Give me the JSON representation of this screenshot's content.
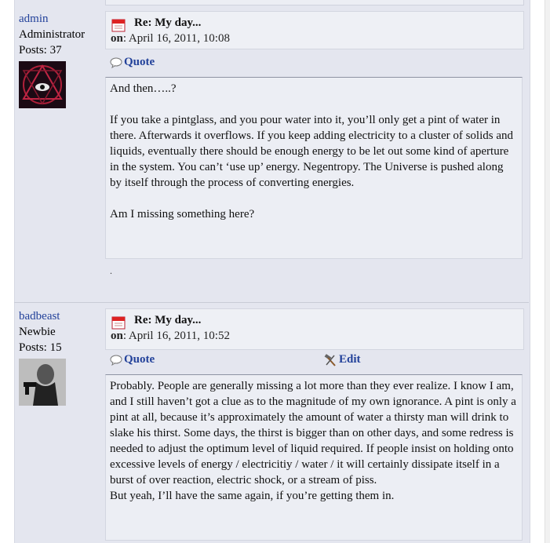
{
  "posts": [
    {
      "poster": {
        "name": "admin",
        "role": "Administrator",
        "posts": "Posts: 37"
      },
      "subject": "Re: My day...",
      "date_label": "on",
      "date_value": ": April 16, 2011, 10:08",
      "actions": {
        "quote": "Quote"
      },
      "body": [
        "And then…..?",
        "",
        "If you take a pintglass, and you pour water into it, you’ll only get a pint of water in there. Afterwards it overflows. If you keep adding electricity to a cluster of solids and liquids, eventually there should be enough energy to be let out some kind of aperture in the system. You can’t ‘use up’ energy. Negentropy. The Universe is pushed along by itself through the process of converting energies.",
        "",
        "Am I missing something here?"
      ],
      "signature": "."
    },
    {
      "poster": {
        "name": "badbeast",
        "role": "Newbie",
        "posts": "Posts: 15"
      },
      "subject": "Re: My day...",
      "date_label": "on",
      "date_value": ": April 16, 2011, 10:52",
      "actions": {
        "quote": "Quote",
        "edit": "Edit"
      },
      "body": [
        "Probably. People are generally missing a lot more than they ever realize. I know I am, and I still haven’t got a clue as to the magnitude of my own ignorance. A pint is only a pint at all, because it’s approximately the amount of water a thirsty man will drink to slake his thirst. Some days, the thirst is bigger than on other days, and some redress is needed to adjust the optimum level of liquid required. If people insist on holding onto excessive levels of energy / electricitiy / water / it will certainly dissipate itself in a burst of over reaction, electric shock, or a stream of piss.",
        "But yeah, I’ll have the same again, if you’re getting them in."
      ]
    }
  ],
  "colors": {
    "link": "#22419a",
    "background": "#e4e6ef",
    "box": "#eef0f5"
  },
  "icons": [
    "calendar-icon",
    "quote-bubble-icon",
    "edit-hammer-icon"
  ]
}
